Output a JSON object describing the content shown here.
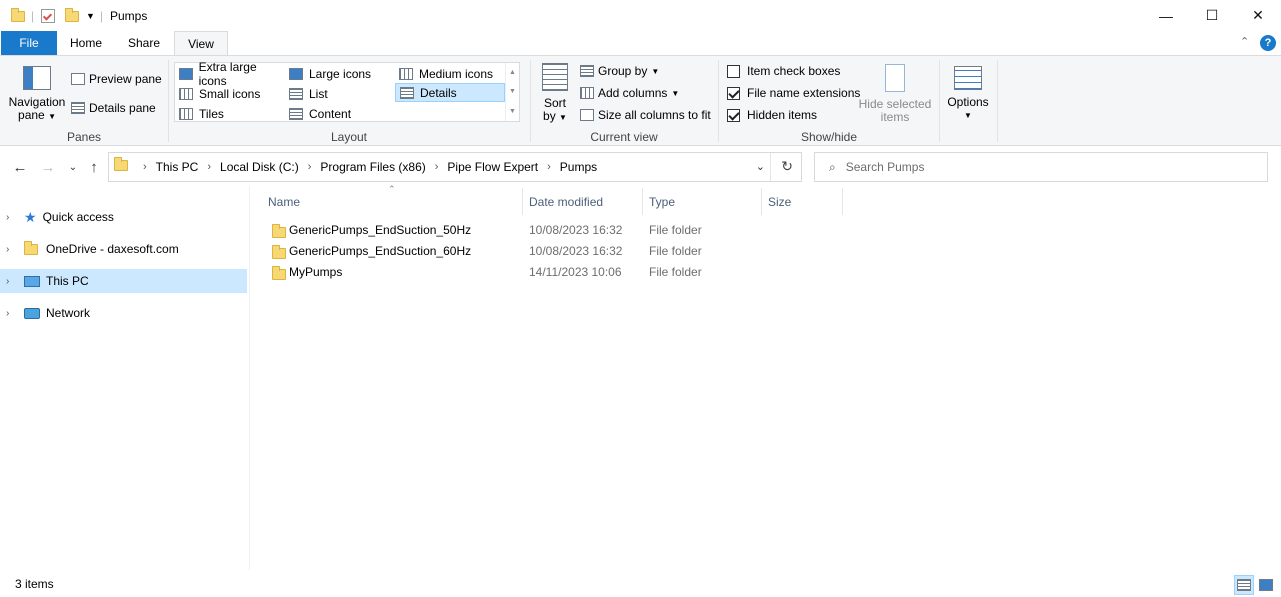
{
  "window": {
    "title": "Pumps",
    "minimize_glyph": "—",
    "maximize_glyph": "☐",
    "close_glyph": "✕"
  },
  "tabs": [
    {
      "label": "File"
    },
    {
      "label": "Home"
    },
    {
      "label": "Share"
    },
    {
      "label": "View"
    }
  ],
  "ribbon": {
    "panes": {
      "label": "Panes",
      "navigation_pane_line1": "Navigation",
      "navigation_pane_line2": "pane",
      "preview_pane": "Preview pane",
      "details_pane": "Details pane"
    },
    "layout": {
      "label": "Layout",
      "items": [
        "Extra large icons",
        "Large icons",
        "Medium icons",
        "Small icons",
        "List",
        "Details",
        "Tiles",
        "Content"
      ],
      "selected": "Details"
    },
    "current_view": {
      "label": "Current view",
      "sort_line1": "Sort",
      "sort_line2": "by",
      "group_by": "Group by",
      "add_columns": "Add columns",
      "size_all_columns": "Size all columns to fit"
    },
    "show_hide": {
      "label": "Show/hide",
      "item_check_boxes": "Item check boxes",
      "file_name_extensions": "File name extensions",
      "hidden_items": "Hidden items",
      "hide_selected_line1": "Hide selected",
      "hide_selected_line2": "items",
      "checks": {
        "item_check_boxes": false,
        "file_name_extensions": true,
        "hidden_items": true
      }
    },
    "options": "Options"
  },
  "address": {
    "breadcrumbs": [
      "This PC",
      "Local Disk (C:)",
      "Program Files (x86)",
      "Pipe Flow Expert",
      "Pumps"
    ]
  },
  "search": {
    "placeholder": "Search Pumps"
  },
  "nav_pane": {
    "items": [
      {
        "label": "Quick access",
        "icon": "star-icon"
      },
      {
        "label": "OneDrive - daxesoft.com",
        "icon": "folder-icon"
      },
      {
        "label": "This PC",
        "icon": "computer-icon",
        "selected": true
      },
      {
        "label": "Network",
        "icon": "network-icon"
      }
    ]
  },
  "file_list": {
    "columns": [
      "Name",
      "Date modified",
      "Type",
      "Size"
    ],
    "rows": [
      {
        "name": "GenericPumps_EndSuction_50Hz",
        "date": "10/08/2023 16:32",
        "type": "File folder",
        "size": ""
      },
      {
        "name": "GenericPumps_EndSuction_60Hz",
        "date": "10/08/2023 16:32",
        "type": "File folder",
        "size": ""
      },
      {
        "name": "MyPumps",
        "date": "14/11/2023 10:06",
        "type": "File folder",
        "size": ""
      }
    ]
  },
  "status": {
    "item_count": "3 items"
  },
  "colors": {
    "accent": "#1979ca",
    "selection": "#cce8ff",
    "folder": "#f8d775"
  }
}
